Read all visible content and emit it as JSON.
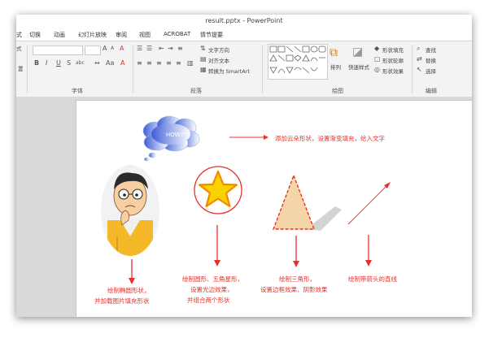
{
  "window": {
    "title": "result.pptx - PowerPoint"
  },
  "tabs": [
    {
      "label": "式"
    },
    {
      "label": "切换"
    },
    {
      "label": "动画"
    },
    {
      "label": "幻灯片放映"
    },
    {
      "label": "审阅"
    },
    {
      "label": "视图"
    },
    {
      "label": "ACROBAT"
    },
    {
      "label": "情节提要"
    }
  ],
  "ribbon": {
    "groups": {
      "font": "字体",
      "paragraph": "段落",
      "drawing": "绘图",
      "editing": "编辑"
    },
    "paragraph": {
      "text_direction": "文字方向",
      "align_text": "对齐文本",
      "smartart": "转换为 SmartArt"
    },
    "drawing": {
      "arrange": "排列",
      "quick_styles": "快速样式",
      "shape_fill": "形状填充",
      "shape_outline": "形状轮廓",
      "shape_effects": "形状效果"
    },
    "editing": {
      "find": "查找",
      "replace": "替换",
      "select": "选择"
    },
    "font_buttons": {
      "bold": "B",
      "italic": "I",
      "underline": "U",
      "strike": "S",
      "shadow": "abc",
      "grow": "A",
      "shrink": "A",
      "clear": "A"
    },
    "left_fragments": {
      "top": "式",
      "bottom": "置"
    }
  },
  "slide": {
    "cloud_text": "HOW??",
    "captions": {
      "cloud": "添加云朵形状，设置渐变填充，给入文字",
      "oval_line1": "绘制椭圆形状，",
      "oval_line2": "并加载图片填充形状",
      "star_line1": "绘制圆形、五角星形，",
      "star_line2": "设置光边效果，",
      "star_line3": "并组合两个形状",
      "tri_line1": "绘制三角形，",
      "tri_line2": "设置边框效果、阴影效果",
      "line": "绘制带箭头的直线"
    }
  },
  "colors": {
    "accent": "#e8302a",
    "star_fill": "#f9d200",
    "star_stroke": "#f28a00",
    "triangle_fill": "#f5d6a8",
    "cloud_from": "#3d5fd6",
    "cloud_to": "#ffffff"
  }
}
